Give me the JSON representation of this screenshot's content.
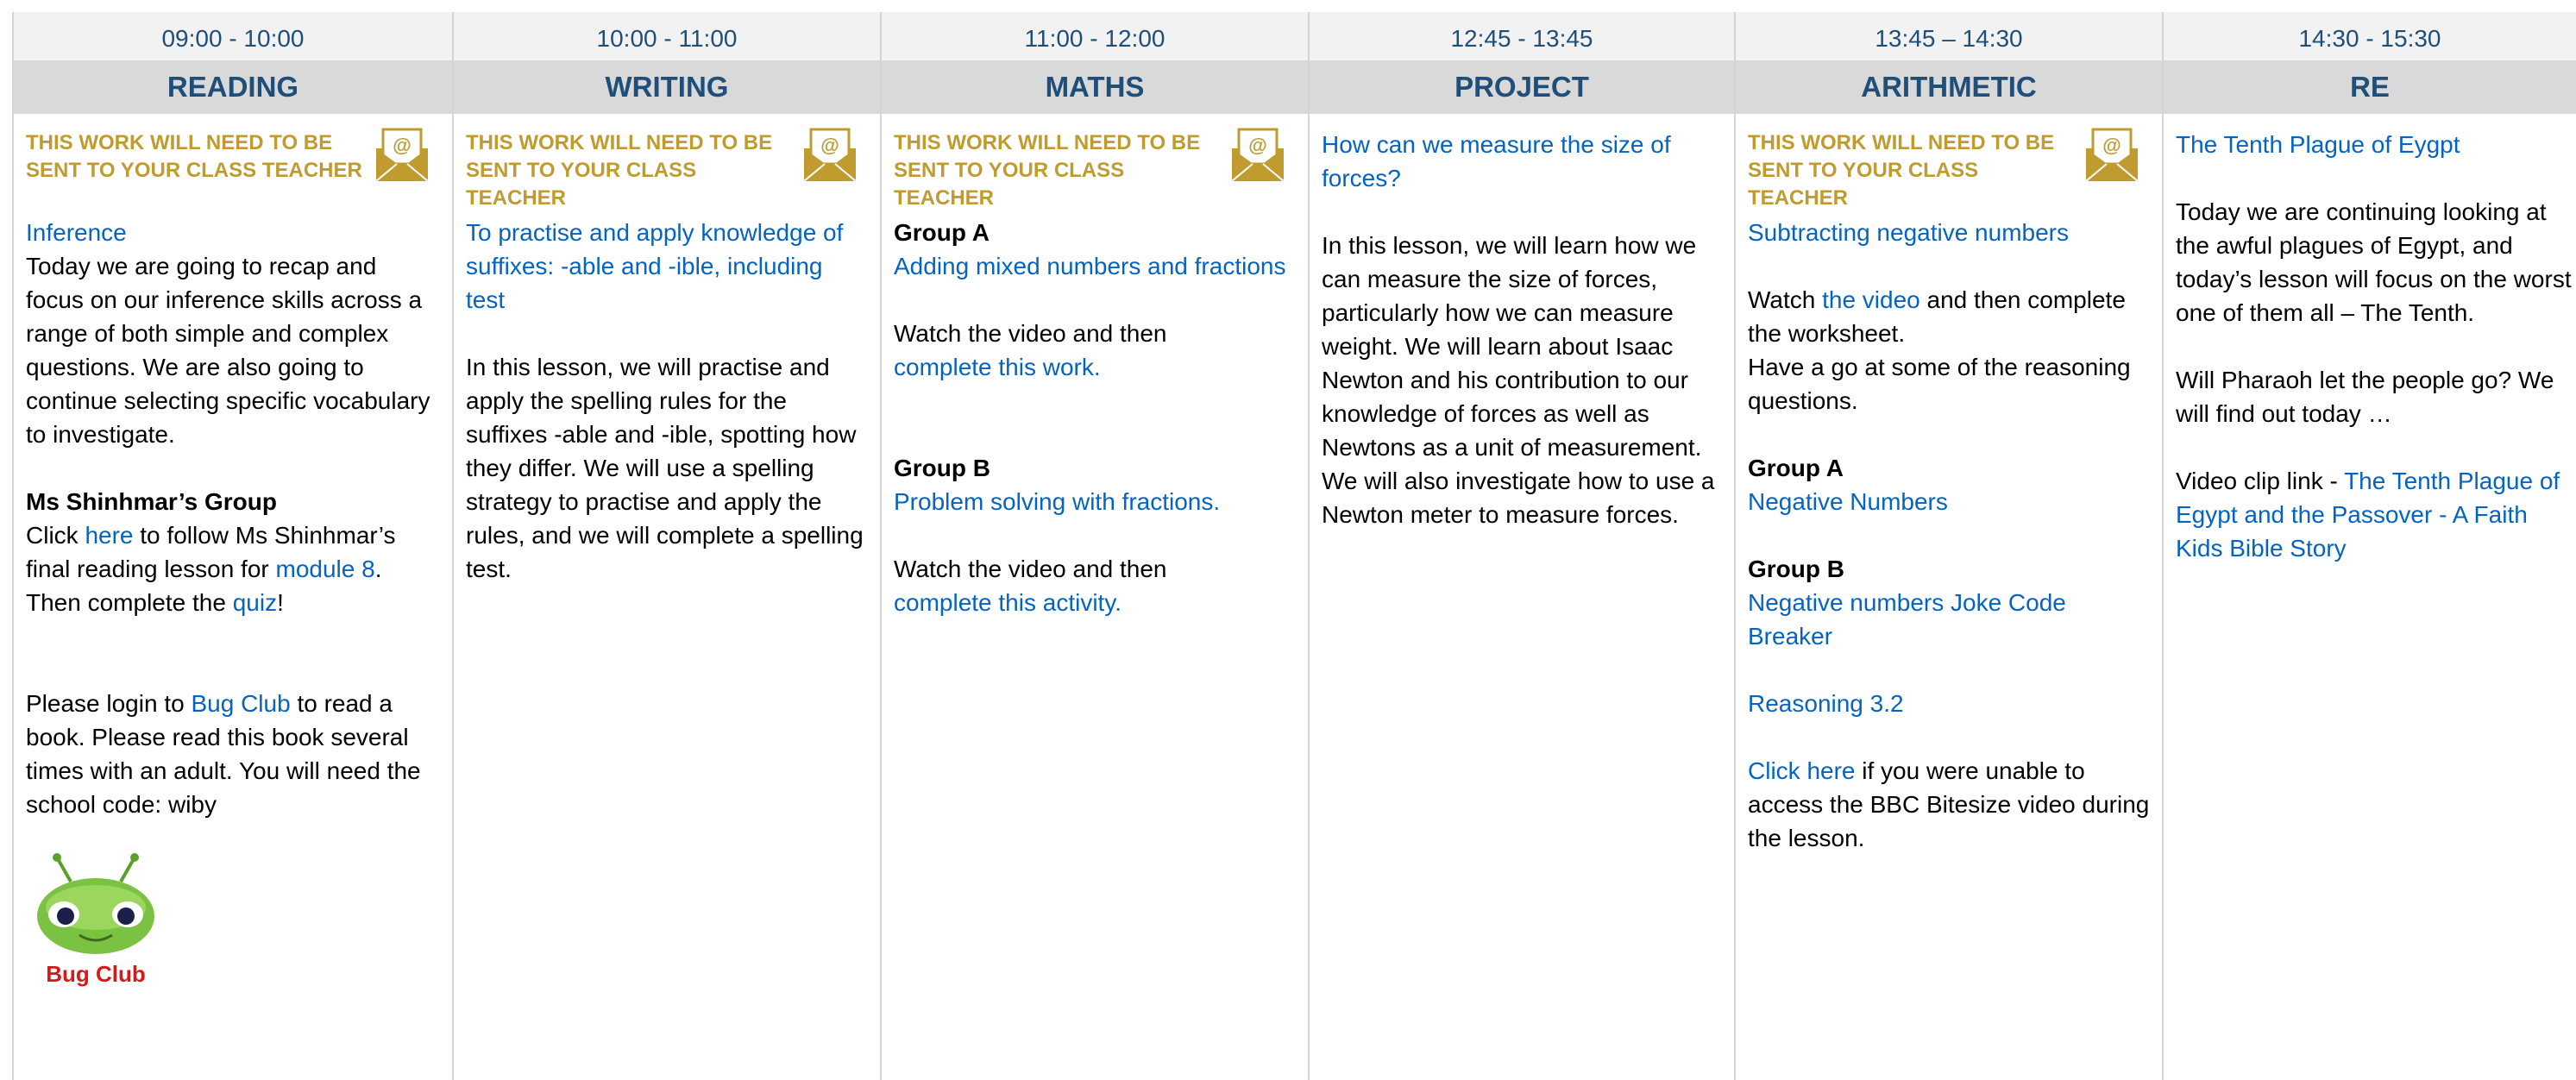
{
  "notice_text": "THIS WORK WILL NEED TO BE SENT TO YOUR CLASS TEACHER",
  "columns": [
    {
      "time": "09:00 - 10:00",
      "subject": "READING",
      "title": "Inference",
      "intro": "Today we are going to recap and focus on our inference skills across a range of both simple and complex questions. We are also going to continue selecting specific vocabulary to investigate.",
      "group_heading": "Ms Shinhmar’s Group",
      "click": "Click",
      "here": "here",
      "follow": "to follow Ms Shinhmar’s final reading lesson for",
      "module": "module 8",
      "then": ". Then complete the",
      "quiz": "quiz",
      "excl": "!",
      "login_pre": "Please login to",
      "bugclub_link": "Bug Club",
      "login_post": "to read a book. Please read this book several times with an adult. You will need the school code: wiby",
      "logo_text": "Bug Club"
    },
    {
      "time": "10:00 - 11:00",
      "subject": "WRITING",
      "title": "To practise and apply knowledge of suffixes: -able and -ible, including test",
      "body": "In this lesson, we will practise and apply the spelling rules for the suffixes -able and -ible, spotting how they differ. We will use a spelling strategy to practise and apply the rules, and we will complete a spelling test."
    },
    {
      "time": "11:00 - 12:00",
      "subject": "MATHS",
      "group_a": "Group A",
      "group_a_link": "Adding mixed numbers and fractions",
      "watch_a": "Watch the video and then",
      "watch_a_link": "complete this work.",
      "group_b": "Group B",
      "group_b_link": "Problem solving with fractions.",
      "watch_b": "Watch the video and then",
      "watch_b_link": "complete this activity."
    },
    {
      "time": "12:45 - 13:45",
      "subject": "PROJECT",
      "title": "How can we measure the size of forces?",
      "body": "In this lesson, we will learn how we can measure the size of forces, particularly how we can measure weight. We will learn about Isaac Newton and his contribution to our knowledge of forces as well as Newtons as a unit of measurement. We will also investigate how to use a Newton meter to measure forces."
    },
    {
      "time": "13:45 – 14:30",
      "subject": "ARITHMETIC",
      "title": "Subtracting negative numbers",
      "watch": "Watch",
      "video_link": "the video",
      "watch_rest": "and then complete the worksheet.",
      "reasoning": "Have a go at some of the reasoning questions.",
      "group_a": "Group A",
      "group_a_link": "Negative Numbers",
      "group_b": "Group B",
      "group_b_link": "Negative numbers Joke Code Breaker",
      "reasoning_link": "Reasoning 3.2",
      "click_here": "Click here",
      "click_rest": "if you were unable to access the BBC Bitesize video during the lesson."
    },
    {
      "time": "14:30 - 15:30",
      "subject": "RE",
      "title": "The Tenth Plague of Eygpt",
      "body1": "Today we are continuing looking at the awful plagues of Egypt, and today’s lesson will focus on the worst one of them all – The Tenth.",
      "body2": "Will Pharaoh let the people go? We will find out today …",
      "clip_pre": "Video clip link -",
      "clip_link": "The Tenth Plague of Egypt and the Passover - A Faith Kids Bible Story"
    }
  ],
  "colors": {
    "header_text": "#1f4e79",
    "notice": "#bf9b30",
    "link": "#0563c1",
    "time_bg": "#f2f2f2",
    "subject_bg": "#d9d9d9"
  }
}
